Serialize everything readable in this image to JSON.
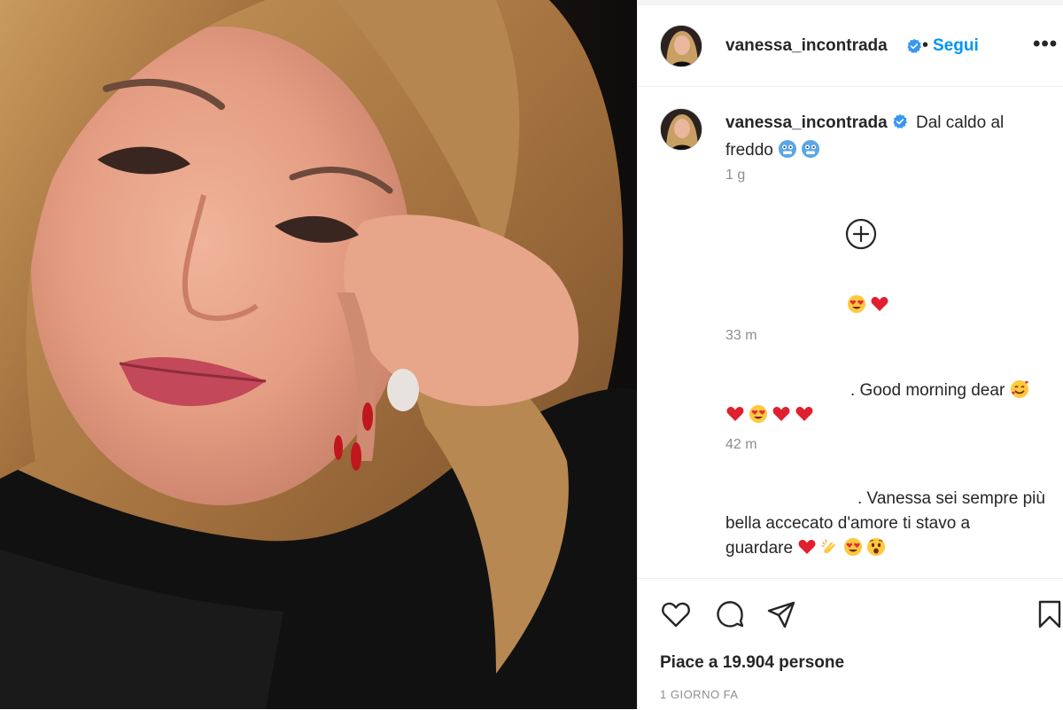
{
  "post": {
    "username": "vanessa_incontrada",
    "follow_label": "Segui",
    "separator": "•",
    "more_label": "•••",
    "caption": {
      "text": "Dal caldo al freddo",
      "emoji": [
        "cold-face",
        "cold-face"
      ],
      "time": "1 g"
    },
    "likes_text": "Piace a 19.904 persone",
    "date_text": "1 GIORNO FA"
  },
  "comments": [
    {
      "text": "",
      "lines": [
        {
          "text": "",
          "emoji": [
            "heart-eyes",
            "red-heart"
          ]
        }
      ],
      "time": "33 m"
    },
    {
      "text": ".",
      "lines": [
        {
          "text": ".  Good morning dear",
          "emoji": [
            "smiling-hearts"
          ]
        },
        {
          "text": "",
          "emoji": [
            "red-heart",
            "heart-eyes",
            "red-heart",
            "red-heart"
          ]
        }
      ],
      "time": "42 m"
    },
    {
      "lines": [
        {
          "text": ".  Vanessa sei sempre più",
          "emoji": []
        },
        {
          "text": "bella accecato d'amore ti stavo a",
          "emoji": []
        },
        {
          "text": "guardare",
          "emoji": [
            "red-heart",
            "clapping-hands",
            "heart-eyes",
            "astonished-face"
          ]
        }
      ]
    }
  ],
  "colors": {
    "link_blue": "#0095f6",
    "text": "#262626",
    "muted": "#8e8e8e",
    "border": "#efefef",
    "verified": "#3897f0"
  },
  "icons": [
    "verified-badge-icon",
    "add-circle-icon",
    "heart-icon",
    "comment-icon",
    "share-icon",
    "bookmark-icon"
  ]
}
